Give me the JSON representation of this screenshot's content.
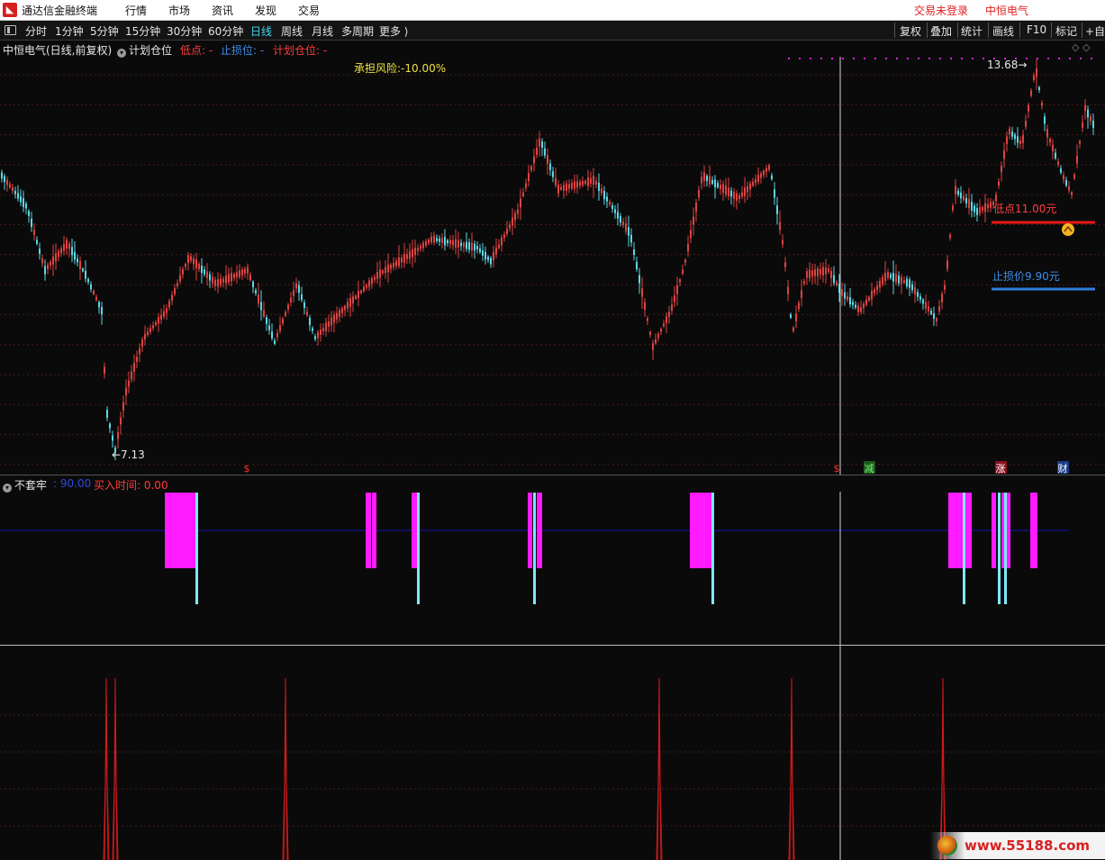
{
  "titlebar": {
    "app_title": "通达信金融终端",
    "menus": [
      "行情",
      "市场",
      "资讯",
      "发现",
      "交易"
    ],
    "login_status": "交易未登录",
    "stock_title": "中恒电气"
  },
  "toolbar": {
    "periods": [
      "分时",
      "1分钟",
      "5分钟",
      "15分钟",
      "30分钟",
      "60分钟",
      "日线",
      "周线",
      "月线",
      "多周期",
      "更多 ⟩"
    ],
    "active_period": "日线",
    "right_buttons": [
      "复权",
      "叠加",
      "统计",
      "画线",
      "F10",
      "标记",
      "+自"
    ]
  },
  "main_chart": {
    "stock_label": "中恒电气(日线,前复权)",
    "indicator_name": "计划仓位",
    "low_label": "低点: -",
    "stop_label": "止损位: -",
    "plan_label": "计划仓位: -",
    "risk_label": "承担风险:-10.00%",
    "high_marker": "13.68",
    "low_marker": "7.13",
    "low_point_label": "低点11.00元",
    "stop_price_label": "止损价9.90元",
    "event_markers": [
      "$",
      "$",
      "减",
      "涨",
      "财"
    ],
    "colors": {
      "up": "#e04242",
      "down": "#5ad8e6",
      "low_line": "#e81818",
      "stop_line": "#2f7fdc",
      "risk": "#f0e040"
    }
  },
  "indicator1": {
    "name": "不套牢",
    "value_label": ": 90.00",
    "buy_label": "买入时间: 0.00",
    "colors": {
      "bar": "#ff1aff",
      "signal": "#7ee8f8",
      "level": "#1414b0"
    }
  },
  "indicator2": {
    "colors": {
      "spike": "#d01a1a"
    }
  },
  "watermark": {
    "text": "www.55188.com"
  }
}
